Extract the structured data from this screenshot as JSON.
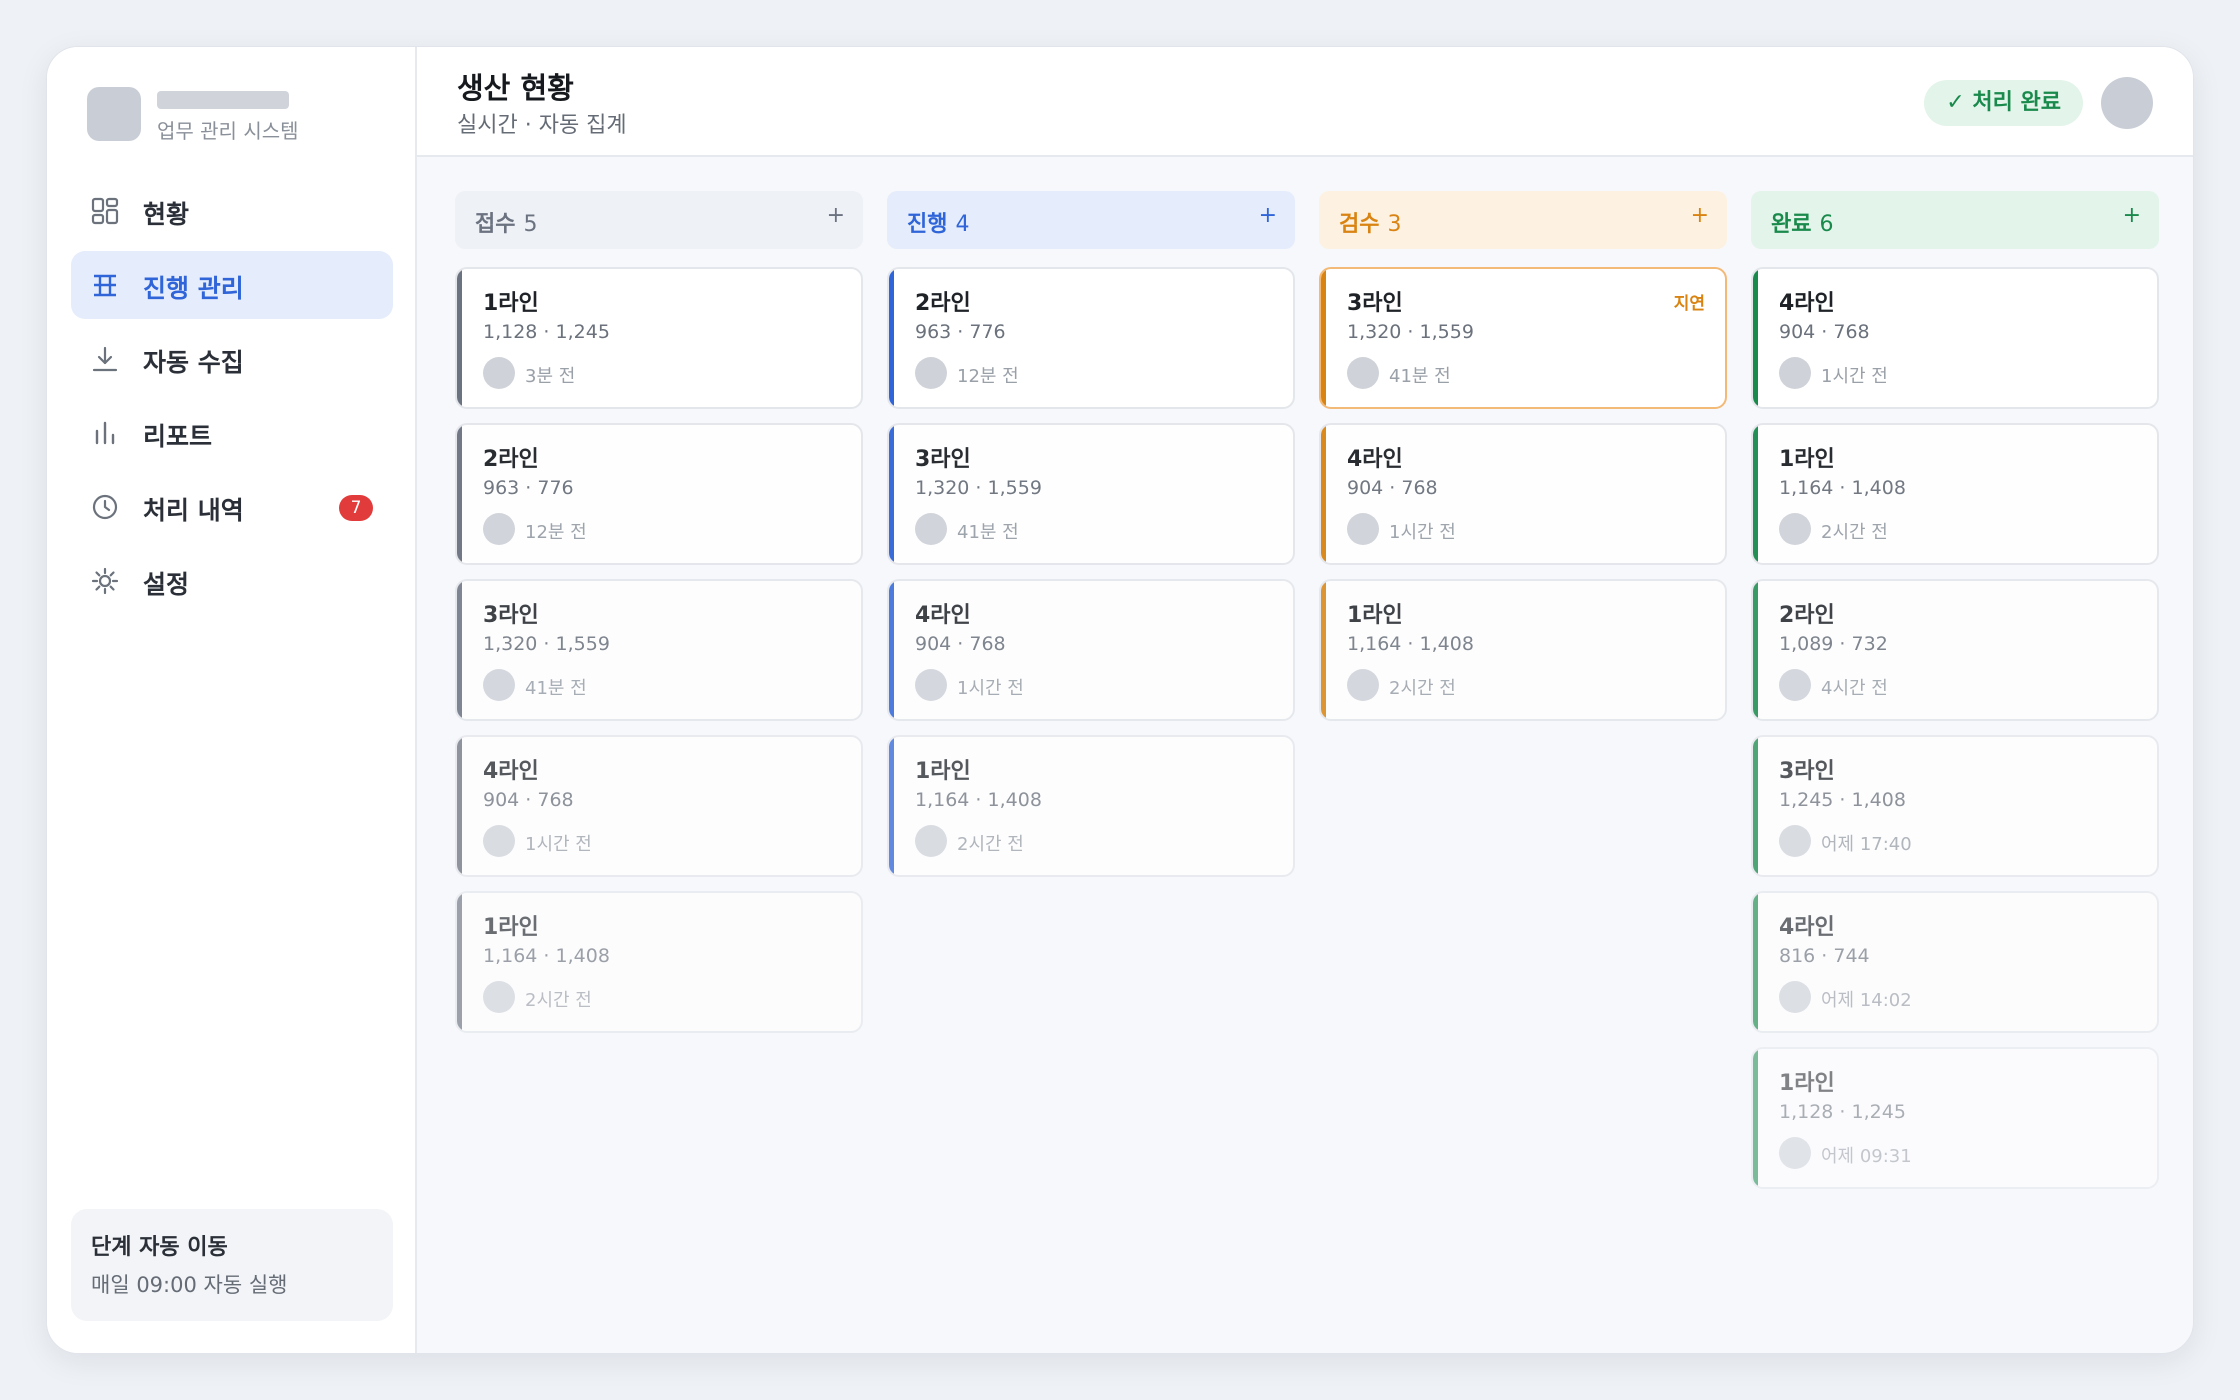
{
  "brand": {
    "subtitle": "업무 관리 시스템"
  },
  "sidebar": {
    "items": [
      {
        "label": "현황",
        "icon": "dashboard-icon"
      },
      {
        "label": "진행 관리",
        "icon": "board-icon",
        "active": true
      },
      {
        "label": "자동 수집",
        "icon": "download-icon"
      },
      {
        "label": "리포트",
        "icon": "chart-icon"
      },
      {
        "label": "처리 내역",
        "icon": "clock-icon",
        "badge": "7"
      },
      {
        "label": "설정",
        "icon": "gear-icon"
      }
    ],
    "auto_card": {
      "title": "단계 자동 이동",
      "subtitle": "매일 09:00 자동 실행"
    }
  },
  "header": {
    "title": "생산 현황",
    "subtitle": "실시간 · 자동 집계",
    "status": "✓ 처리 완료"
  },
  "colors": {
    "accent": "#2f65d8",
    "danger": "#e23b3b",
    "success": "#198a4c",
    "warning": "#d98412"
  },
  "columns": [
    {
      "title": "접수",
      "count": "5",
      "add": "+",
      "color": "#6b7280",
      "head_bg": "#eef1f6",
      "accent": "#6b7280",
      "cards": [
        {
          "title": "1라인",
          "nums": "1,128 · 1,245",
          "time": "3분 전"
        },
        {
          "title": "2라인",
          "nums": "963 · 776",
          "time": "12분 전"
        },
        {
          "title": "3라인",
          "nums": "1,320 · 1,559",
          "time": "41분 전"
        },
        {
          "title": "4라인",
          "nums": "904 · 768",
          "time": "1시간 전"
        },
        {
          "title": "1라인",
          "nums": "1,164 · 1,408",
          "time": "2시간 전"
        }
      ]
    },
    {
      "title": "진행",
      "count": "4",
      "add": "+",
      "color": "#2f65d8",
      "head_bg": "#e5ecfb",
      "accent": "#2f65d8",
      "cards": [
        {
          "title": "2라인",
          "nums": "963 · 776",
          "time": "12분 전"
        },
        {
          "title": "3라인",
          "nums": "1,320 · 1,559",
          "time": "41분 전"
        },
        {
          "title": "4라인",
          "nums": "904 · 768",
          "time": "1시간 전"
        },
        {
          "title": "1라인",
          "nums": "1,164 · 1,408",
          "time": "2시간 전"
        }
      ]
    },
    {
      "title": "검수",
      "count": "3",
      "add": "+",
      "color": "#d98412",
      "head_bg": "#fdf1e2",
      "accent": "#d98412",
      "cards": [
        {
          "title": "3라인",
          "nums": "1,320 · 1,559",
          "time": "41분 전",
          "flag": "지연"
        },
        {
          "title": "4라인",
          "nums": "904 · 768",
          "time": "1시간 전"
        },
        {
          "title": "1라인",
          "nums": "1,164 · 1,408",
          "time": "2시간 전"
        }
      ]
    },
    {
      "title": "완료",
      "count": "6",
      "add": "+",
      "color": "#198a4c",
      "head_bg": "#e3f4ea",
      "accent": "#198a4c",
      "cards": [
        {
          "title": "4라인",
          "nums": "904 · 768",
          "time": "1시간 전"
        },
        {
          "title": "1라인",
          "nums": "1,164 · 1,408",
          "time": "2시간 전"
        },
        {
          "title": "2라인",
          "nums": "1,089 · 732",
          "time": "4시간 전"
        },
        {
          "title": "3라인",
          "nums": "1,245 · 1,408",
          "time": "어제 17:40"
        },
        {
          "title": "4라인",
          "nums": "816 · 744",
          "time": "어제 14:02"
        },
        {
          "title": "1라인",
          "nums": "1,128 · 1,245",
          "time": "어제 09:31"
        }
      ]
    }
  ]
}
